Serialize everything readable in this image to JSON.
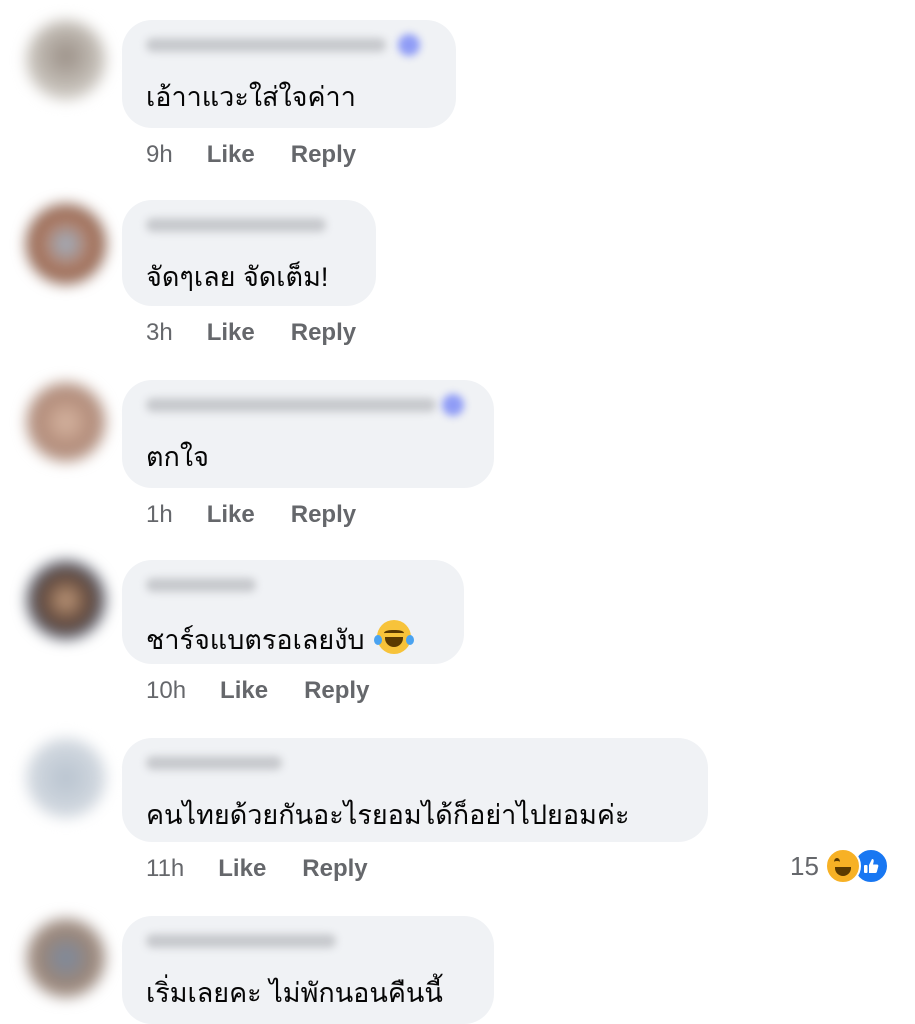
{
  "comments": [
    {
      "text": "เอ้าาแวะใส่ใจค่าา",
      "time": "9h",
      "like": "Like",
      "reply": "Reply"
    },
    {
      "text": "จัดๆเลย จัดเต็ม!",
      "time": "3h",
      "like": "Like",
      "reply": "Reply"
    },
    {
      "text": "ตกใจ",
      "time": "1h",
      "like": "Like",
      "reply": "Reply"
    },
    {
      "text": "ชาร์จแบตรอเลยงับ",
      "emoji": "laughing-tears-emoji",
      "time": "10h",
      "like": "Like",
      "reply": "Reply"
    },
    {
      "text": "คนไทยด้วยกันอะไรยอมได้ก็อย่าไปยอมค่ะ",
      "time": "11h",
      "like": "Like",
      "reply": "Reply",
      "reaction_count": "15",
      "reaction_icons": [
        "haha-reaction-icon",
        "like-reaction-icon"
      ]
    },
    {
      "text": "เริ่มเลยคะ ไม่พักนอนคืนนี้"
    }
  ],
  "colors": {
    "bubble": "#f0f2f5",
    "meta": "#65676b",
    "like_blue": "#1877f2",
    "haha_yellow": "#f7b125"
  }
}
